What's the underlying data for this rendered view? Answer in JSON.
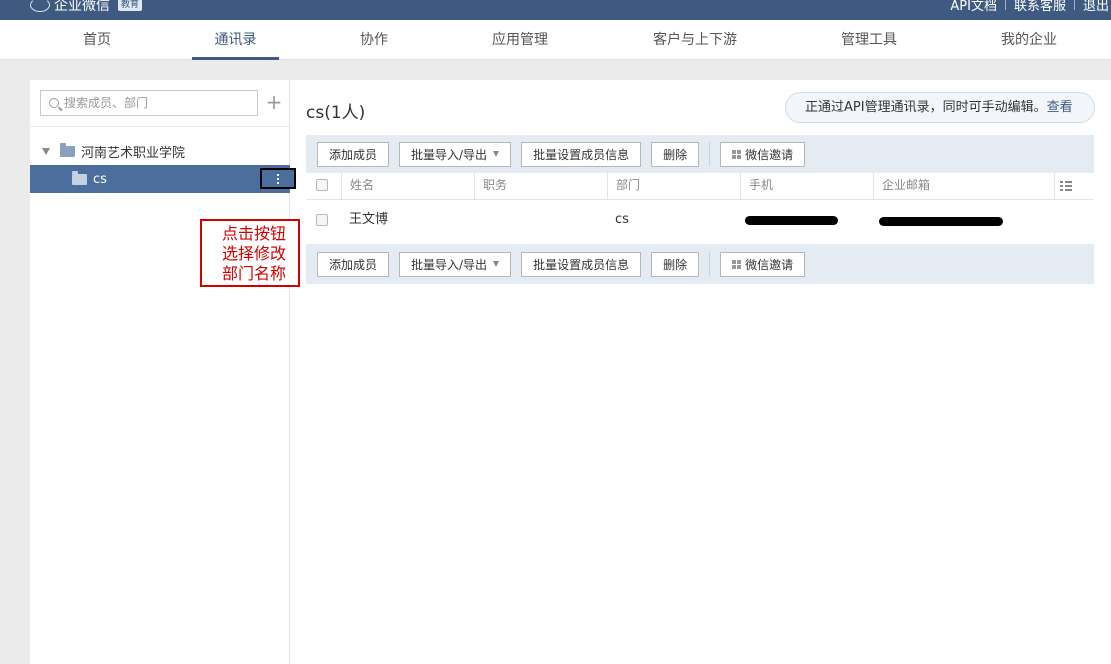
{
  "header": {
    "brand": "企业微信",
    "brand_badge": "教育",
    "links": [
      "API文档",
      "联系客服",
      "退出"
    ]
  },
  "nav": {
    "items": [
      "首页",
      "通讯录",
      "协作",
      "应用管理",
      "客户与上下游",
      "管理工具",
      "我的企业"
    ],
    "active": "通讯录"
  },
  "sidebar": {
    "search_placeholder": "搜索成员、部门",
    "add_label": "+",
    "root_dept": "河南艺术职业学院",
    "child_dept": "cs"
  },
  "annotation": {
    "lines": [
      "点击按钮",
      "选择修改",
      "部门名称"
    ]
  },
  "main": {
    "title": "cs(1人)",
    "api_notice": "正通过API管理通讯录，同时可手动编辑。",
    "api_notice_link": "查看",
    "toolbar": {
      "add_member": "添加成员",
      "import_export": "批量导入/导出",
      "batch_set": "批量设置成员信息",
      "delete": "删除",
      "wechat_invite": "微信邀请"
    },
    "table": {
      "columns": [
        "姓名",
        "职务",
        "部门",
        "手机",
        "企业邮箱"
      ],
      "rows": [
        {
          "name": "王文博",
          "title": "",
          "dept": "cs"
        }
      ]
    }
  },
  "colors": {
    "header_bg": "#3e5a80",
    "selected_dept_bg": "#4b6e9c",
    "toolbar_bg": "#e5ebf2",
    "annotation_red": "#d40000"
  }
}
